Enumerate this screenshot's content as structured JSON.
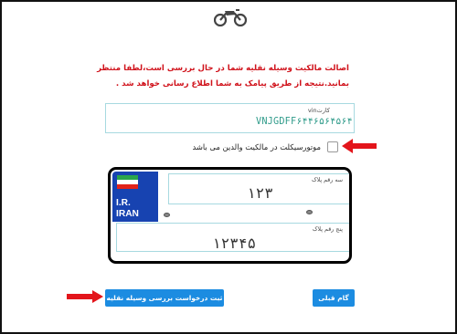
{
  "header": {
    "icon": "motorcycle-icon"
  },
  "notice": {
    "line1": "اصالت مالکیت وسیله نقلیه شما در حال بررسی است،لطفا منتظر",
    "line2": "بمانید.نتیجه از طریق پیامک به شما اطلاع رسانی خواهد شد ."
  },
  "vin": {
    "label": "vinکارت",
    "value": "VNJGDFF۶۴۴۶۵۶۴۵۶۴"
  },
  "owner_checkbox": {
    "label": "موتورسیکلت در مالکیت والدین می باشد",
    "checked": false
  },
  "plate": {
    "country_line1": "I.R.",
    "country_line2": "IRAN",
    "three_digit_label": "سه رقم پلاک",
    "three_digit_value": "۱۲۳",
    "five_digit_label": "پنج رقم پلاک",
    "five_digit_value": "۱۲۳۴۵"
  },
  "buttons": {
    "submit": "ثبت درخواست بررسی وسیله نقلیه",
    "previous": "گام قبلی"
  },
  "colors": {
    "notice": "#d0121b",
    "accent": "#1c8ce1",
    "arrow": "#e3151b",
    "plate_blue": "#1743b1"
  }
}
